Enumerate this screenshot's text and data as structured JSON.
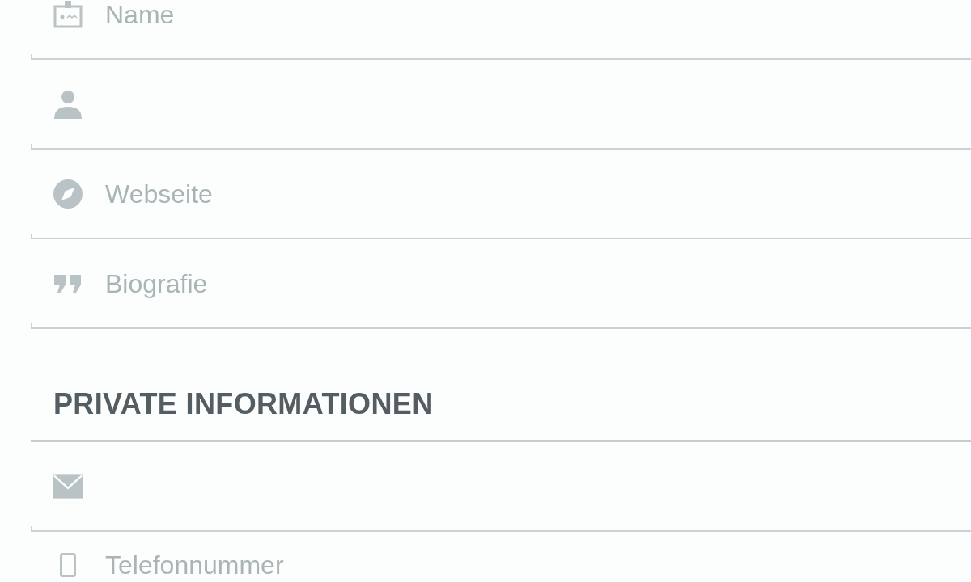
{
  "sections": [
    {
      "fields": [
        {
          "kind": "name",
          "placeholder": "Name"
        },
        {
          "kind": "user"
        },
        {
          "kind": "website",
          "placeholder": "Webseite"
        },
        {
          "kind": "bio",
          "placeholder": "Biografie"
        }
      ]
    },
    {
      "heading": "PRIVATE INFORMATIONEN",
      "fields": [
        {
          "kind": "email"
        },
        {
          "kind": "phone",
          "placeholder": "Telefonnummer"
        }
      ]
    }
  ]
}
